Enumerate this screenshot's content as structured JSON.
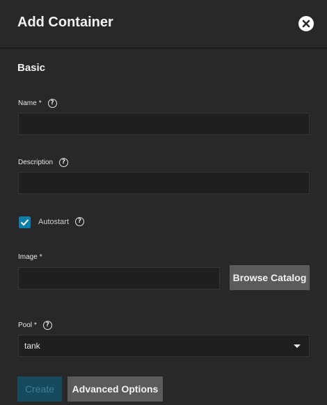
{
  "header": {
    "title": "Add Container",
    "close_icon": "close-circle-icon"
  },
  "section": {
    "title": "Basic"
  },
  "fields": {
    "name": {
      "label": "Name",
      "required": "*",
      "value": "",
      "placeholder": ""
    },
    "description": {
      "label": "Description",
      "value": "",
      "placeholder": ""
    },
    "autostart": {
      "label": "Autostart",
      "checked": true
    },
    "image": {
      "label": "Image",
      "required": "*",
      "value": "",
      "placeholder": ""
    },
    "pool": {
      "label": "Pool",
      "required": "*",
      "selected": "tank"
    }
  },
  "buttons": {
    "browse_catalog": "Browse Catalog",
    "create": "Create",
    "advanced_options": "Advanced Options"
  },
  "help_glyph": "?",
  "colors": {
    "background": "#282828",
    "input_bg": "#1f1f1f",
    "accent": "#0d7ea8",
    "button_bg": "#5b5b5b",
    "disabled_primary": "#154a5f"
  }
}
